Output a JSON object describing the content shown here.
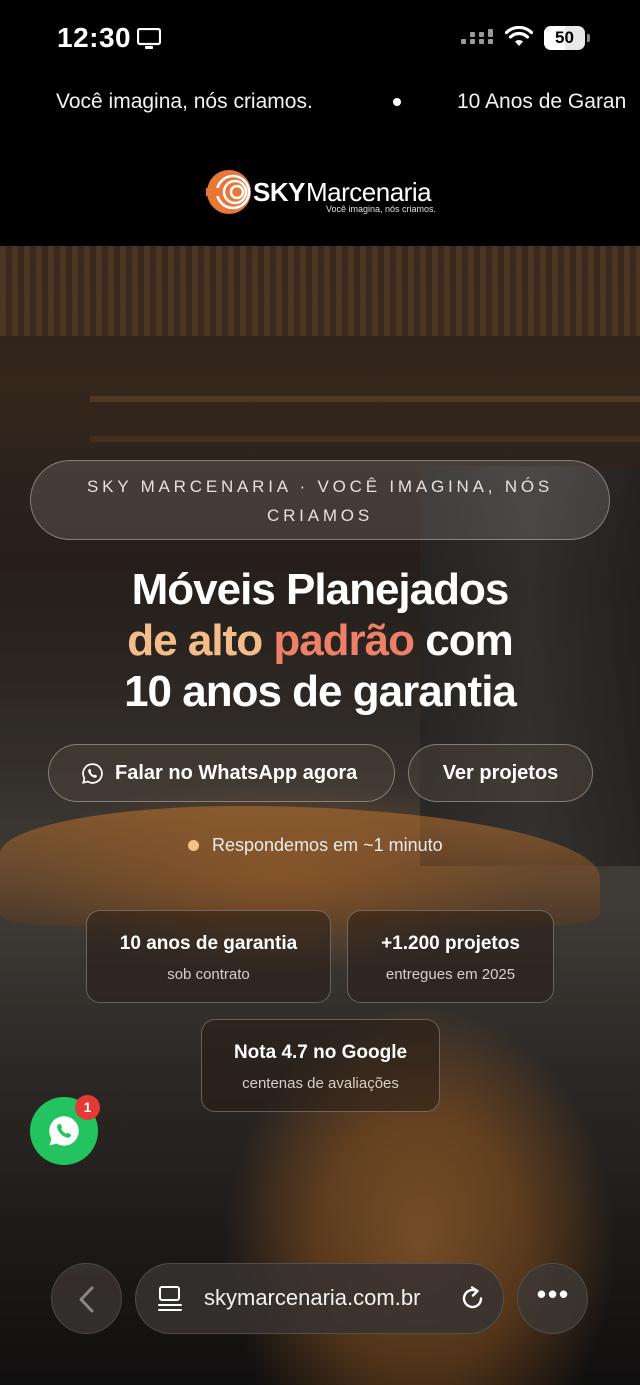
{
  "status_bar": {
    "time": "12:30",
    "battery": "50",
    "battery_level": 0.5
  },
  "ticker": {
    "items": [
      "Você imagina, nós criamos.",
      "10 Anos de Garan"
    ]
  },
  "logo": {
    "sky": "SKY",
    "marcenaria": "Marcenaria",
    "tagline": "Você imagina, nós criamos."
  },
  "hero": {
    "eyebrow_line1": "SKY MARCENARIA · VOCÊ IMAGINA, NÓS",
    "eyebrow_line2": "CRIAMOS",
    "headline_line1": "Móveis Planejados",
    "headline_gold": "de alto ",
    "headline_coral": "padrão",
    "headline_rest": " com",
    "headline_line3": "10 anos de garantia",
    "cta_whatsapp": "Falar no WhatsApp agora",
    "cta_projects": "Ver projetos",
    "response_note": "Respondemos em ~1 minuto",
    "colors": {
      "gold": "#f2bd8a",
      "coral": "#ee8069"
    }
  },
  "highlights": [
    {
      "title": "10 anos de garantia",
      "subtitle": "sob contrato"
    },
    {
      "title": "+1.200 projetos",
      "subtitle": "entregues em 2025"
    },
    {
      "title": "Nota 4.7 no Google",
      "subtitle": "centenas de avaliações"
    }
  ],
  "whatsapp_fab": {
    "badge": "1",
    "color": "#23c45f"
  },
  "browser": {
    "url": "skymarcenaria.com.br",
    "more": "•••"
  }
}
